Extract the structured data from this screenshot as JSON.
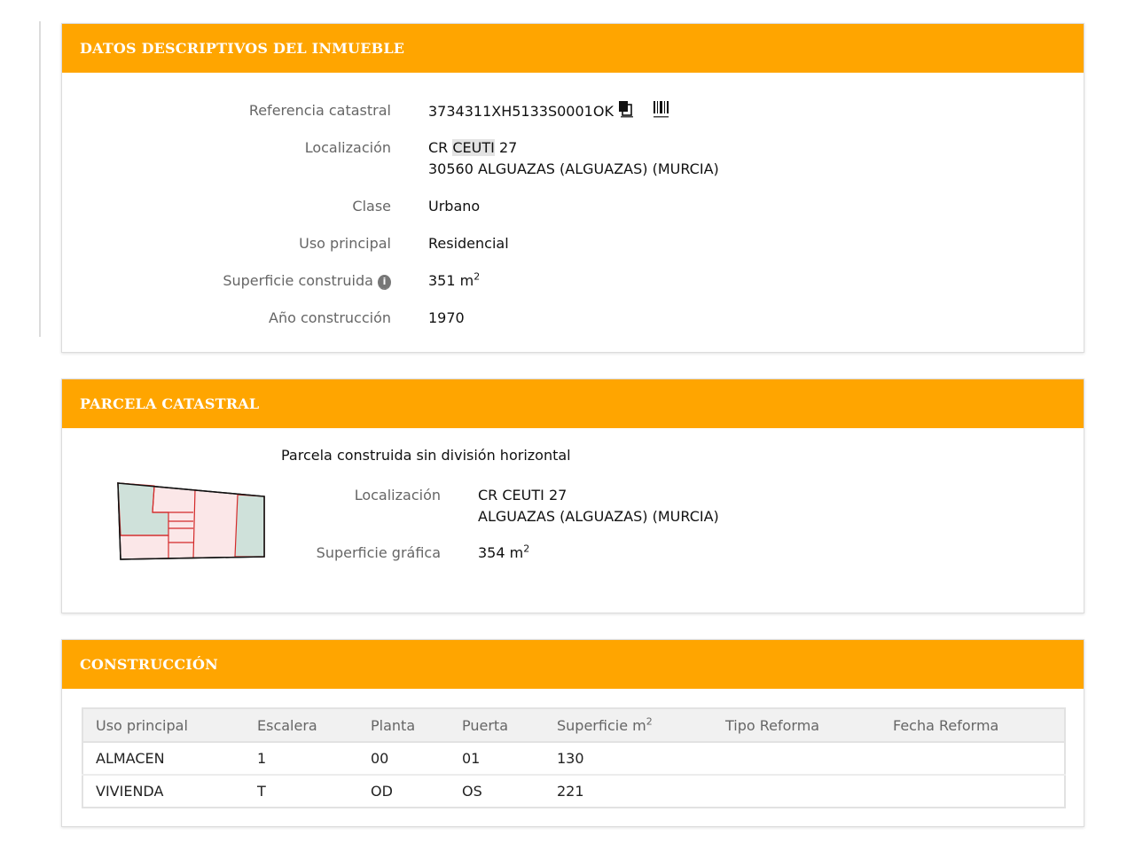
{
  "inmueble": {
    "header": "DATOS DESCRIPTIVOS DEL INMUEBLE",
    "ref_label": "Referencia catastral",
    "ref_value": "3734311XH5133S0001OK",
    "loc_label": "Localización",
    "loc_line1_pre": "CR ",
    "loc_line1_highlight": "CEUTI",
    "loc_line1_post": " 27",
    "loc_line2": "30560 ALGUAZAS (ALGUAZAS) (MURCIA)",
    "clase_label": "Clase",
    "clase_value": "Urbano",
    "uso_label": "Uso principal",
    "uso_value": "Residencial",
    "sup_label": "Superficie construida",
    "sup_value": "351 m",
    "sup_unit_sup": "2",
    "anio_label": "Año construcción",
    "anio_value": "1970"
  },
  "parcela": {
    "header": "PARCELA CATASTRAL",
    "title": "Parcela construida sin división horizontal",
    "loc_label": "Localización",
    "loc_line1": "CR CEUTI 27",
    "loc_line2": "ALGUAZAS (ALGUAZAS) (MURCIA)",
    "sup_label": "Superficie gráfica",
    "sup_value": "354 m",
    "sup_unit_sup": "2"
  },
  "construccion": {
    "header": "CONSTRUCCIÓN",
    "columns": [
      "Uso principal",
      "Escalera",
      "Planta",
      "Puerta",
      "Superficie m",
      "Tipo Reforma",
      "Fecha Reforma"
    ],
    "col_sup": "2",
    "rows": [
      [
        "ALMACEN",
        "1",
        "00",
        "01",
        "130",
        "",
        ""
      ],
      [
        "VIVIENDA",
        "T",
        "OD",
        "OS",
        "221",
        "",
        ""
      ]
    ]
  },
  "icons": {
    "copy": "copy-icon",
    "barcode": "barcode-icon",
    "info": "info-icon"
  },
  "colors": {
    "header_bg": "#ffa500",
    "header_text": "#ffffff",
    "plot_outline": "#111111",
    "plot_red": "#d42a2a",
    "plot_green": "#cfe1da",
    "plot_pink": "#fbe7e8"
  }
}
